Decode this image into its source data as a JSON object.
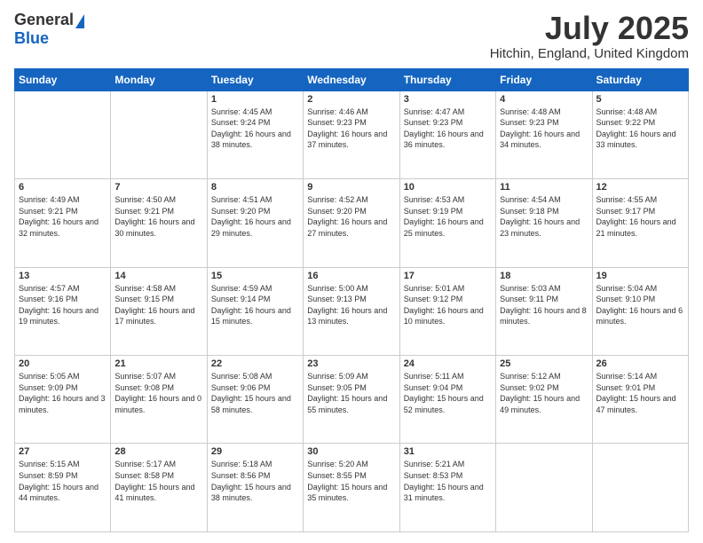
{
  "logo": {
    "general": "General",
    "blue": "Blue"
  },
  "title": {
    "month_year": "July 2025",
    "location": "Hitchin, England, United Kingdom"
  },
  "days_of_week": [
    "Sunday",
    "Monday",
    "Tuesday",
    "Wednesday",
    "Thursday",
    "Friday",
    "Saturday"
  ],
  "weeks": [
    [
      {
        "day": "",
        "sunrise": "",
        "sunset": "",
        "daylight": ""
      },
      {
        "day": "",
        "sunrise": "",
        "sunset": "",
        "daylight": ""
      },
      {
        "day": "1",
        "sunrise": "Sunrise: 4:45 AM",
        "sunset": "Sunset: 9:24 PM",
        "daylight": "Daylight: 16 hours and 38 minutes."
      },
      {
        "day": "2",
        "sunrise": "Sunrise: 4:46 AM",
        "sunset": "Sunset: 9:23 PM",
        "daylight": "Daylight: 16 hours and 37 minutes."
      },
      {
        "day": "3",
        "sunrise": "Sunrise: 4:47 AM",
        "sunset": "Sunset: 9:23 PM",
        "daylight": "Daylight: 16 hours and 36 minutes."
      },
      {
        "day": "4",
        "sunrise": "Sunrise: 4:48 AM",
        "sunset": "Sunset: 9:23 PM",
        "daylight": "Daylight: 16 hours and 34 minutes."
      },
      {
        "day": "5",
        "sunrise": "Sunrise: 4:48 AM",
        "sunset": "Sunset: 9:22 PM",
        "daylight": "Daylight: 16 hours and 33 minutes."
      }
    ],
    [
      {
        "day": "6",
        "sunrise": "Sunrise: 4:49 AM",
        "sunset": "Sunset: 9:21 PM",
        "daylight": "Daylight: 16 hours and 32 minutes."
      },
      {
        "day": "7",
        "sunrise": "Sunrise: 4:50 AM",
        "sunset": "Sunset: 9:21 PM",
        "daylight": "Daylight: 16 hours and 30 minutes."
      },
      {
        "day": "8",
        "sunrise": "Sunrise: 4:51 AM",
        "sunset": "Sunset: 9:20 PM",
        "daylight": "Daylight: 16 hours and 29 minutes."
      },
      {
        "day": "9",
        "sunrise": "Sunrise: 4:52 AM",
        "sunset": "Sunset: 9:20 PM",
        "daylight": "Daylight: 16 hours and 27 minutes."
      },
      {
        "day": "10",
        "sunrise": "Sunrise: 4:53 AM",
        "sunset": "Sunset: 9:19 PM",
        "daylight": "Daylight: 16 hours and 25 minutes."
      },
      {
        "day": "11",
        "sunrise": "Sunrise: 4:54 AM",
        "sunset": "Sunset: 9:18 PM",
        "daylight": "Daylight: 16 hours and 23 minutes."
      },
      {
        "day": "12",
        "sunrise": "Sunrise: 4:55 AM",
        "sunset": "Sunset: 9:17 PM",
        "daylight": "Daylight: 16 hours and 21 minutes."
      }
    ],
    [
      {
        "day": "13",
        "sunrise": "Sunrise: 4:57 AM",
        "sunset": "Sunset: 9:16 PM",
        "daylight": "Daylight: 16 hours and 19 minutes."
      },
      {
        "day": "14",
        "sunrise": "Sunrise: 4:58 AM",
        "sunset": "Sunset: 9:15 PM",
        "daylight": "Daylight: 16 hours and 17 minutes."
      },
      {
        "day": "15",
        "sunrise": "Sunrise: 4:59 AM",
        "sunset": "Sunset: 9:14 PM",
        "daylight": "Daylight: 16 hours and 15 minutes."
      },
      {
        "day": "16",
        "sunrise": "Sunrise: 5:00 AM",
        "sunset": "Sunset: 9:13 PM",
        "daylight": "Daylight: 16 hours and 13 minutes."
      },
      {
        "day": "17",
        "sunrise": "Sunrise: 5:01 AM",
        "sunset": "Sunset: 9:12 PM",
        "daylight": "Daylight: 16 hours and 10 minutes."
      },
      {
        "day": "18",
        "sunrise": "Sunrise: 5:03 AM",
        "sunset": "Sunset: 9:11 PM",
        "daylight": "Daylight: 16 hours and 8 minutes."
      },
      {
        "day": "19",
        "sunrise": "Sunrise: 5:04 AM",
        "sunset": "Sunset: 9:10 PM",
        "daylight": "Daylight: 16 hours and 6 minutes."
      }
    ],
    [
      {
        "day": "20",
        "sunrise": "Sunrise: 5:05 AM",
        "sunset": "Sunset: 9:09 PM",
        "daylight": "Daylight: 16 hours and 3 minutes."
      },
      {
        "day": "21",
        "sunrise": "Sunrise: 5:07 AM",
        "sunset": "Sunset: 9:08 PM",
        "daylight": "Daylight: 16 hours and 0 minutes."
      },
      {
        "day": "22",
        "sunrise": "Sunrise: 5:08 AM",
        "sunset": "Sunset: 9:06 PM",
        "daylight": "Daylight: 15 hours and 58 minutes."
      },
      {
        "day": "23",
        "sunrise": "Sunrise: 5:09 AM",
        "sunset": "Sunset: 9:05 PM",
        "daylight": "Daylight: 15 hours and 55 minutes."
      },
      {
        "day": "24",
        "sunrise": "Sunrise: 5:11 AM",
        "sunset": "Sunset: 9:04 PM",
        "daylight": "Daylight: 15 hours and 52 minutes."
      },
      {
        "day": "25",
        "sunrise": "Sunrise: 5:12 AM",
        "sunset": "Sunset: 9:02 PM",
        "daylight": "Daylight: 15 hours and 49 minutes."
      },
      {
        "day": "26",
        "sunrise": "Sunrise: 5:14 AM",
        "sunset": "Sunset: 9:01 PM",
        "daylight": "Daylight: 15 hours and 47 minutes."
      }
    ],
    [
      {
        "day": "27",
        "sunrise": "Sunrise: 5:15 AM",
        "sunset": "Sunset: 8:59 PM",
        "daylight": "Daylight: 15 hours and 44 minutes."
      },
      {
        "day": "28",
        "sunrise": "Sunrise: 5:17 AM",
        "sunset": "Sunset: 8:58 PM",
        "daylight": "Daylight: 15 hours and 41 minutes."
      },
      {
        "day": "29",
        "sunrise": "Sunrise: 5:18 AM",
        "sunset": "Sunset: 8:56 PM",
        "daylight": "Daylight: 15 hours and 38 minutes."
      },
      {
        "day": "30",
        "sunrise": "Sunrise: 5:20 AM",
        "sunset": "Sunset: 8:55 PM",
        "daylight": "Daylight: 15 hours and 35 minutes."
      },
      {
        "day": "31",
        "sunrise": "Sunrise: 5:21 AM",
        "sunset": "Sunset: 8:53 PM",
        "daylight": "Daylight: 15 hours and 31 minutes."
      },
      {
        "day": "",
        "sunrise": "",
        "sunset": "",
        "daylight": ""
      },
      {
        "day": "",
        "sunrise": "",
        "sunset": "",
        "daylight": ""
      }
    ]
  ]
}
